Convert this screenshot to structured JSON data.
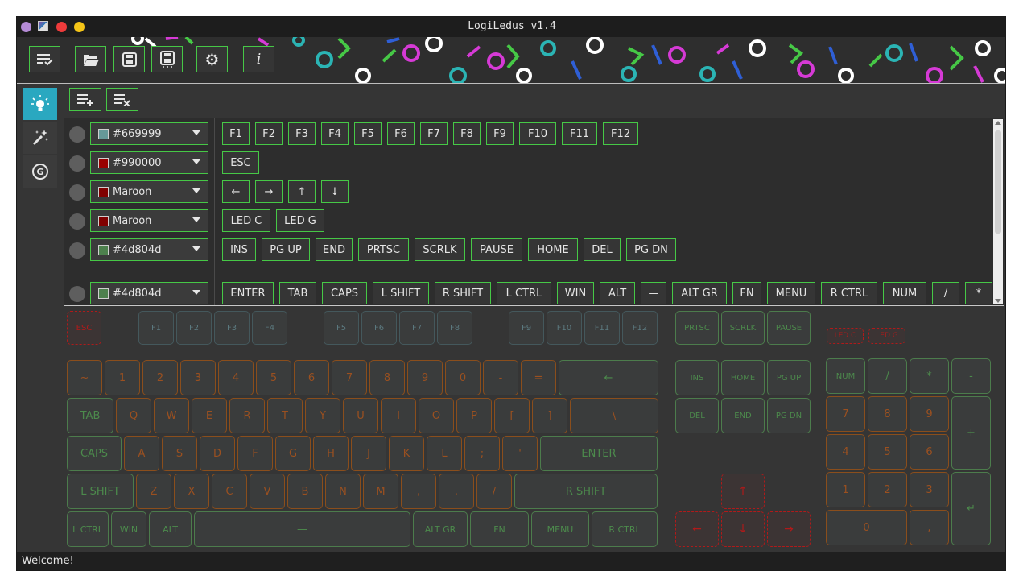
{
  "window": {
    "title": "LogiLedus v1.4"
  },
  "toolbar": [
    {
      "name": "edit-list-button",
      "icon": "list-check-icon",
      "glyph": "☰"
    },
    {
      "name": "open-button",
      "icon": "folder-open-icon",
      "glyph": "📂"
    },
    {
      "name": "save-button",
      "icon": "save-icon",
      "glyph": "💾"
    },
    {
      "name": "save-as-button",
      "icon": "save-as-icon",
      "glyph": "💾"
    },
    {
      "name": "settings-button",
      "icon": "gear-icon",
      "glyph": "⚙"
    },
    {
      "name": "info-button",
      "icon": "info-icon",
      "glyph": "i"
    }
  ],
  "sidebar": [
    {
      "name": "lighting-tab",
      "icon": "lightbulb-icon",
      "glyph": "💡",
      "active": true
    },
    {
      "name": "effects-tab",
      "icon": "magic-wand-icon",
      "glyph": "✦",
      "active": false
    },
    {
      "name": "g-keys-tab",
      "icon": "g-logo-icon",
      "glyph": "Ⓖ",
      "active": false
    }
  ],
  "subtoolbar": [
    {
      "name": "add-row-button",
      "icon": "list-add-icon",
      "glyph": "≡+"
    },
    {
      "name": "remove-row-button",
      "icon": "list-remove-icon",
      "glyph": "≡×"
    }
  ],
  "rows": [
    {
      "color": "#669999",
      "label": "#669999",
      "keys": [
        "F1",
        "F2",
        "F3",
        "F4",
        "F5",
        "F6",
        "F7",
        "F8",
        "F9",
        "F10",
        "F11",
        "F12"
      ]
    },
    {
      "color": "#990000",
      "label": "#990000",
      "keys": [
        "ESC"
      ]
    },
    {
      "color": "#800000",
      "label": "Maroon",
      "keys": [
        "←",
        "→",
        "↑",
        "↓"
      ]
    },
    {
      "color": "#800000",
      "label": "Maroon",
      "keys": [
        "LED C",
        "LED G"
      ]
    },
    {
      "color": "#4d804d",
      "label": "#4d804d",
      "keys": [
        "INS",
        "PG UP",
        "END",
        "PRTSC",
        "SCRLK",
        "PAUSE",
        "HOME",
        "DEL",
        "PG DN"
      ]
    },
    {
      "color": "#4d804d",
      "label": "#4d804d",
      "keys": [
        "ENTER",
        "TAB",
        "CAPS",
        "L SHIFT",
        "R SHIFT",
        "L CTRL",
        "WIN",
        "ALT",
        "—",
        "ALT GR",
        "FN",
        "MENU",
        "R CTRL",
        "NUM",
        "/",
        "*"
      ]
    }
  ],
  "keyboard": {
    "fn_row": {
      "esc": "ESC",
      "f": [
        "F1",
        "F2",
        "F3",
        "F4",
        "F5",
        "F6",
        "F7",
        "F8",
        "F9",
        "F10",
        "F11",
        "F12"
      ],
      "sys": [
        "PRTSC",
        "SCRLK",
        "PAUSE"
      ],
      "leds": [
        "LED C",
        "LED G"
      ]
    },
    "row1": [
      "~",
      "1",
      "2",
      "3",
      "4",
      "5",
      "6",
      "7",
      "8",
      "9",
      "0",
      "-",
      "=",
      "←"
    ],
    "row2": [
      "TAB",
      "Q",
      "W",
      "E",
      "R",
      "T",
      "Y",
      "U",
      "I",
      "O",
      "P",
      "[",
      "]",
      "\\"
    ],
    "row3": [
      "CAPS",
      "A",
      "S",
      "D",
      "F",
      "G",
      "H",
      "J",
      "K",
      "L",
      ";",
      "'",
      "ENTER"
    ],
    "row4": [
      "L SHIFT",
      "Z",
      "X",
      "C",
      "V",
      "B",
      "N",
      "M",
      ",",
      ".",
      "/",
      "R SHIFT"
    ],
    "row5": [
      "L CTRL",
      "WIN",
      "ALT",
      "—",
      "ALT GR",
      "FN",
      "MENU",
      "R CTRL"
    ],
    "nav": [
      "INS",
      "HOME",
      "PG UP",
      "DEL",
      "END",
      "PG DN"
    ],
    "arrows": [
      "↑",
      "←",
      "↓",
      "→"
    ],
    "numpad": [
      "NUM",
      "/",
      "*",
      "-",
      "7",
      "8",
      "9",
      "+",
      "4",
      "5",
      "6",
      "1",
      "2",
      "3",
      "↵",
      "0",
      ","
    ]
  },
  "status": "Welcome!"
}
